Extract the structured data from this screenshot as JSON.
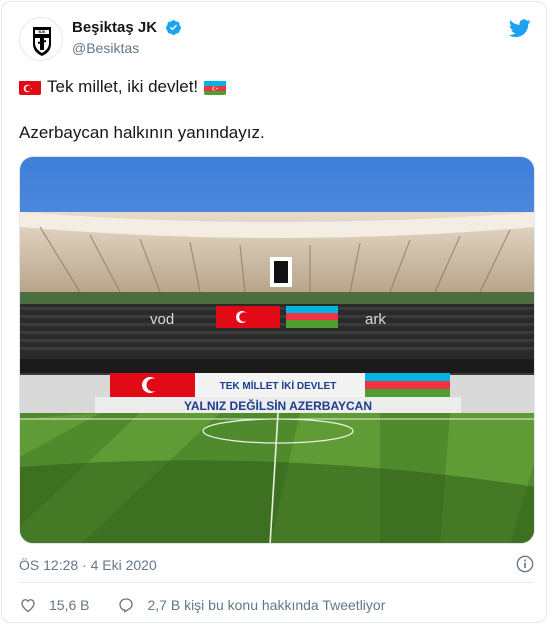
{
  "account": {
    "display_name": "Beşiktaş JK",
    "handle": "@Besiktas",
    "verified": true
  },
  "tweet": {
    "line1_text": "Tek millet, iki devlet!",
    "line2_text": "Azerbaycan halkının yanındayız.",
    "timestamp": "ÖS 12:28 · 4 Eki 2020"
  },
  "media": {
    "banner_top": "TEK MİLLET İKİ DEVLET",
    "banner_bottom": "YALNIZ DEĞİLSİN AZERBAYCAN",
    "stand_text_left": "vod",
    "stand_text_right": "ark"
  },
  "actions": {
    "likes": "15,6 B",
    "conversation": "2,7 B kişi bu konu hakkında Tweetliyor"
  },
  "colors": {
    "twitter_blue": "#1da1f2",
    "secondary_text": "#657786",
    "like_red": "#e0245e"
  },
  "icons": [
    "verified-badge-icon",
    "twitter-bird-icon",
    "turkey-flag-icon",
    "azerbaijan-flag-icon",
    "info-icon",
    "heart-icon",
    "speech-bubble-icon"
  ]
}
